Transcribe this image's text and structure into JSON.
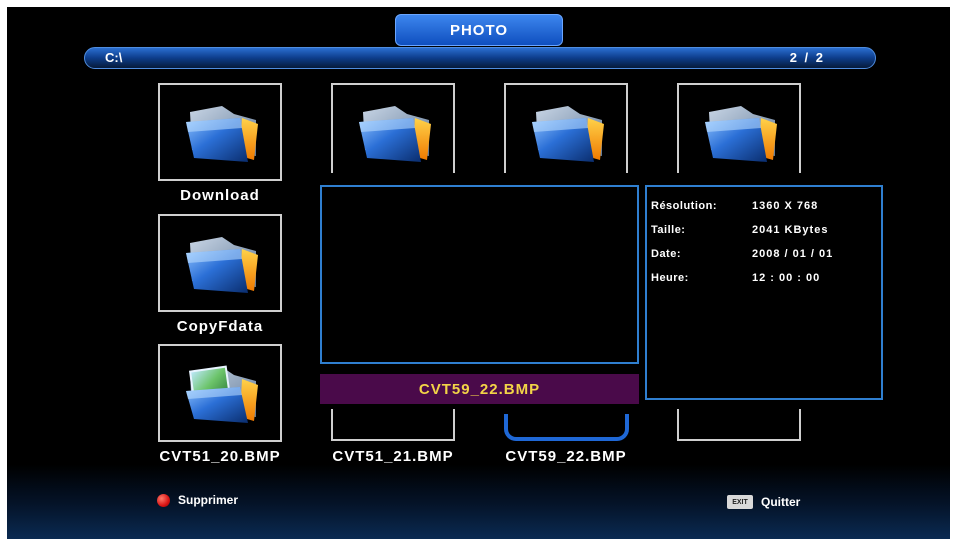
{
  "header": {
    "title": "PHOTO"
  },
  "pathbar": {
    "path": "C:\\",
    "page": "2 / 2"
  },
  "items": [
    {
      "label": "Download",
      "icon": "folder-icon"
    },
    {
      "label": "CopyFdata",
      "icon": "folder-icon"
    },
    {
      "label": "CVT51_20.BMP",
      "icon": "image-folder-icon"
    },
    {
      "label": "CVT51_21.BMP",
      "icon": "folder-icon"
    },
    {
      "label": "CVT59_22.BMP",
      "icon": "folder-icon"
    }
  ],
  "selected_file": "CVT59_22.BMP",
  "info": {
    "resolution_label": "Résolution:",
    "resolution_value": "1360 X 768",
    "size_label": "Taille:",
    "size_value": "2041 KBytes",
    "date_label": "Date:",
    "date_value": "2008 / 01 / 01",
    "time_label": "Heure:",
    "time_value": "12 : 00 : 00"
  },
  "footer": {
    "delete_label": "Supprimer",
    "exit_key": "EXIT",
    "quit_label": "Quitter"
  },
  "colors": {
    "accent": "#1f68d6",
    "selection_bar": "#4a0a4a",
    "selected_text": "#f2d447",
    "delete_button": "#d81414"
  }
}
